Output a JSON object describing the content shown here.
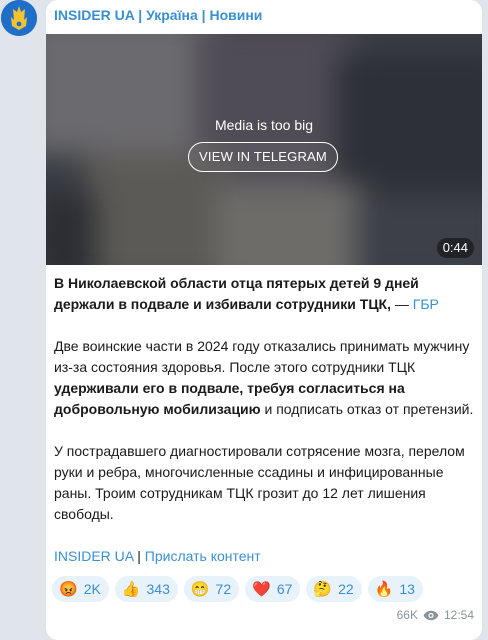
{
  "channel": {
    "name": "INSIDER UA | Україна | Новини"
  },
  "media": {
    "message": "Media is too big",
    "button_label": "VIEW IN TELEGRAM",
    "duration": "0:44"
  },
  "post": {
    "headline": "В Николаевской области отца пятерых детей 9 дней держали в подвале и избивали сотрудники ТЦК,",
    "headline_sep": " — ",
    "headline_source": "ГБР",
    "p2_part1": "Две воинские части в 2024 году отказались принимать мужчину из-за состояния здоровья. После этого сотрудники ТЦК ",
    "p2_bold": "удерживали его в подвале, требуя согласиться на добровольную мобилизацию",
    "p2_part2": " и подписать отказ от претензий.",
    "p3": "У пострадавшего диагностировали сотрясение мозга, перелом руки и ребра, многочисленные ссадины и инфицированные раны. Троим сотрудникам ТЦК грозит до 12 лет лишения свободы.",
    "footer_link1": "INSIDER UA",
    "footer_sep": " | ",
    "footer_link2": "Прислать контент"
  },
  "reactions": [
    {
      "emoji": "😡",
      "count": "2K"
    },
    {
      "emoji": "👍",
      "count": "343"
    },
    {
      "emoji": "😁",
      "count": "72"
    },
    {
      "emoji": "❤️",
      "count": "67"
    },
    {
      "emoji": "🤔",
      "count": "22"
    },
    {
      "emoji": "🔥",
      "count": "13"
    }
  ],
  "meta": {
    "views": "66K",
    "time": "12:54"
  },
  "icons": {
    "views": "eye-icon",
    "avatar": "trident-icon"
  },
  "colors": {
    "link": "#3a8fd1",
    "reaction_bg": "#e8f2fb",
    "bubble": "#ffffff",
    "chat_bg": "#dfe5ea"
  }
}
